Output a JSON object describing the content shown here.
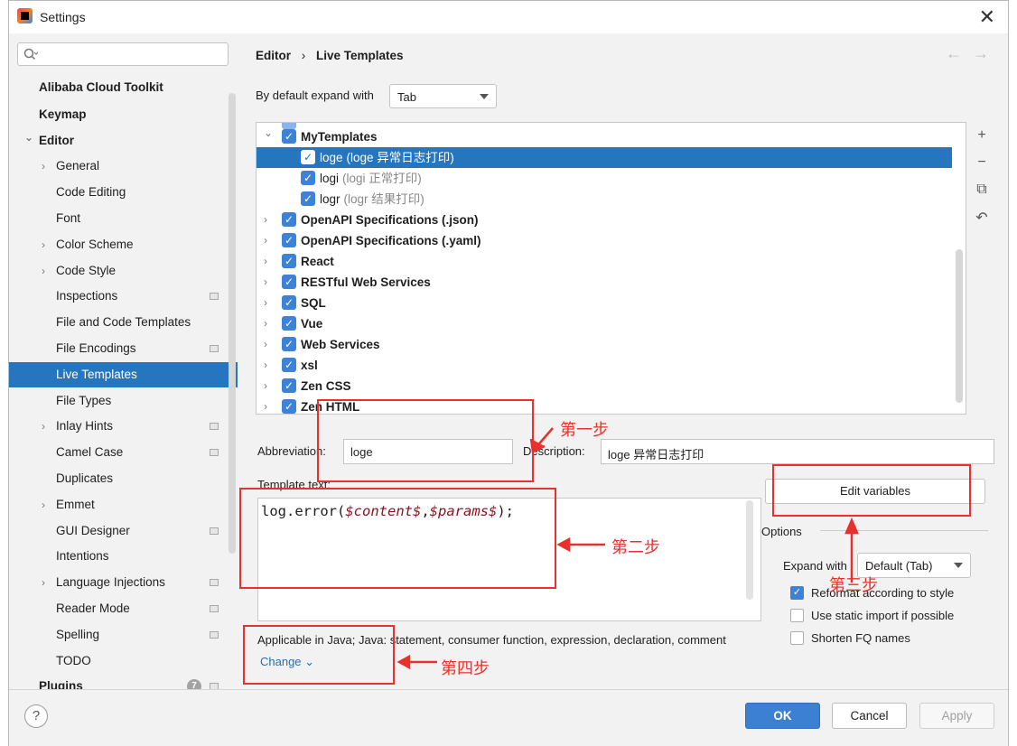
{
  "window": {
    "title": "Settings"
  },
  "sidebar": {
    "search_placeholder": "",
    "items": [
      {
        "label": "Alibaba Cloud Toolkit",
        "bold": true
      },
      {
        "label": "Keymap",
        "bold": true
      },
      {
        "label": "Editor",
        "bold": true,
        "expanded": true
      },
      {
        "label": "General",
        "expandable": true
      },
      {
        "label": "Code Editing"
      },
      {
        "label": "Font"
      },
      {
        "label": "Color Scheme",
        "expandable": true
      },
      {
        "label": "Code Style",
        "expandable": true
      },
      {
        "label": "Inspections",
        "icon": "grid-icon"
      },
      {
        "label": "File and Code Templates"
      },
      {
        "label": "File Encodings",
        "icon": "grid-icon"
      },
      {
        "label": "Live Templates",
        "selected": true
      },
      {
        "label": "File Types"
      },
      {
        "label": "Inlay Hints",
        "expandable": true,
        "icon": "grid-icon"
      },
      {
        "label": "Camel Case",
        "icon": "grid-icon"
      },
      {
        "label": "Duplicates"
      },
      {
        "label": "Emmet",
        "expandable": true
      },
      {
        "label": "GUI Designer",
        "icon": "grid-icon"
      },
      {
        "label": "Intentions"
      },
      {
        "label": "Language Injections",
        "expandable": true,
        "icon": "grid-icon"
      },
      {
        "label": "Reader Mode",
        "icon": "grid-icon"
      },
      {
        "label": "Spelling",
        "icon": "grid-icon"
      },
      {
        "label": "TODO"
      },
      {
        "label": "Plugins",
        "bold": true,
        "badge": "7",
        "icon": "grid-icon"
      }
    ]
  },
  "header": {
    "breadcrumb": [
      "Editor",
      "›",
      "Live Templates"
    ],
    "back_icon": "←",
    "forward_icon": "→"
  },
  "expand_default": {
    "label": "By default expand with",
    "value": "Tab"
  },
  "templates": [
    {
      "label": "MyTemplates",
      "group": true,
      "expanded": true
    },
    {
      "label": "loge",
      "desc": "(loge 异常日志打印)",
      "selected": true
    },
    {
      "label": "logi",
      "desc": "(logi 正常打印)"
    },
    {
      "label": "logr",
      "desc": "(logr 结果打印)"
    },
    {
      "label": "OpenAPI Specifications (.json)",
      "group": true
    },
    {
      "label": "OpenAPI Specifications (.yaml)",
      "group": true
    },
    {
      "label": "React",
      "group": true
    },
    {
      "label": "RESTful Web Services",
      "group": true
    },
    {
      "label": "SQL",
      "group": true
    },
    {
      "label": "Vue",
      "group": true
    },
    {
      "label": "Web Services",
      "group": true
    },
    {
      "label": "xsl",
      "group": true
    },
    {
      "label": "Zen CSS",
      "group": true
    },
    {
      "label": "Zen HTML",
      "group": true
    }
  ],
  "list_tools": [
    "+",
    "−",
    "⧉",
    "↶"
  ],
  "form": {
    "abbreviation_label": "Abbreviation:",
    "abbreviation_value": "loge",
    "description_label": "Description:",
    "description_value": "loge 异常日志打印",
    "template_text_label": "Template text:",
    "code_prefix": "log.error(",
    "code_var1": "$content$",
    "code_sep": ",",
    "code_var2": "$params$",
    "code_suffix": ");",
    "applicable": "Applicable in Java; Java: statement, consumer function, expression, declaration, comment",
    "change_link": "Change ⌄",
    "edit_variables": "Edit variables"
  },
  "options": {
    "title": "Options",
    "expand_with_label": "Expand with",
    "expand_with_value": "Default (Tab)",
    "reformat": "Reformat according to style",
    "reformat_checked": true,
    "static_import": "Use static import if possible",
    "static_import_checked": false,
    "shorten_fq": "Shorten FQ names",
    "shorten_fq_checked": false
  },
  "footer": {
    "help": "?",
    "ok": "OK",
    "cancel": "Cancel",
    "apply": "Apply"
  },
  "annotations": {
    "step1": "第一步",
    "step2": "第二步",
    "step3": "第三步",
    "step4": "第四步"
  },
  "colors": {
    "accent": "#2675bf",
    "annotation": "#e8312c",
    "ok_button": "#3b80d2"
  }
}
